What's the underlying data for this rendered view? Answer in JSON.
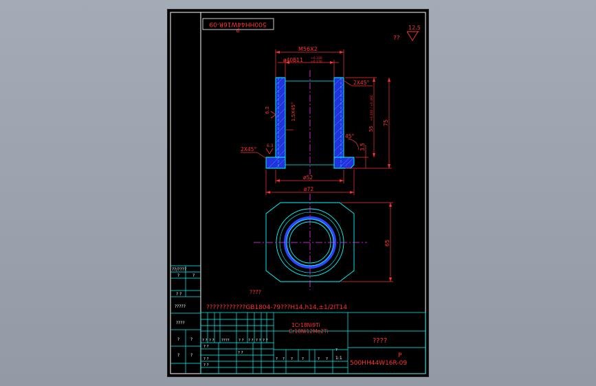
{
  "colors": {
    "background": "#9aa2ad",
    "sheet": "#000000",
    "frame": "#ffffff",
    "title_block_lines": "#00ffff",
    "outline": "#00ffff",
    "hatch": "#3344ff",
    "centerline": "#ff33ff",
    "dimension": "#ff3333",
    "text_white": "#ffffff",
    "text_yellow": "#ffff44"
  },
  "drawing_number_rotated": "500HH44W16R-09",
  "drawing_number_rotated_suffix": "P",
  "roughness": {
    "default_mark": "??",
    "value": "12.5"
  },
  "section_view": {
    "thread": "M56X2",
    "bore_tolerance": "ø40B11",
    "bore_tol_upper": "+0.330",
    "bore_tol_lower": "+0.170",
    "chamfer_top": "2X45°",
    "chamfer_bottom": "2X45°",
    "inner_chamfer": "1.5X45°",
    "angle": "45°",
    "step": "3.5",
    "length_tol": "55",
    "length_tol_detail": "+0.190 / +0.460",
    "total_length": "75",
    "roughness_side": "6.3",
    "roughness_inner": "6.3",
    "dia_inner": "ø52",
    "dia_outer": "ø72"
  },
  "plan_view": {
    "height_dim": "65"
  },
  "notes": {
    "tech_req_title": "????",
    "tech_req_text": "????????????GB1804-79???H14,h14,±1/2IT14"
  },
  "left_column": {
    "row_a": "??/????",
    "row_b": "?",
    "row_b2": "?",
    "row_c": "?  ?",
    "row_d": "?????",
    "row_e": "????",
    "row_f": "?",
    "row_f2": "?",
    "row_g": "?",
    "row_g2": "?"
  },
  "title_block": {
    "material_1": "1Cr18Ni9Ti",
    "material_2": "Cr18Ni12Mo2Ti",
    "part_name": "????",
    "code_prefix": "P",
    "drawing_number": "500HH44W16R-09",
    "scale": "1:1",
    "grid_labels": [
      "?  ?",
      "?  ?",
      "????",
      "?  ?",
      "?  ?",
      "?  ?",
      "?  ?"
    ],
    "approval_labels": [
      "?  ?",
      "?  ?",
      "?  ?",
      "?  ?"
    ],
    "stage_labels": [
      "?",
      "?",
      "?",
      "?",
      "?",
      "?",
      "?"
    ]
  }
}
